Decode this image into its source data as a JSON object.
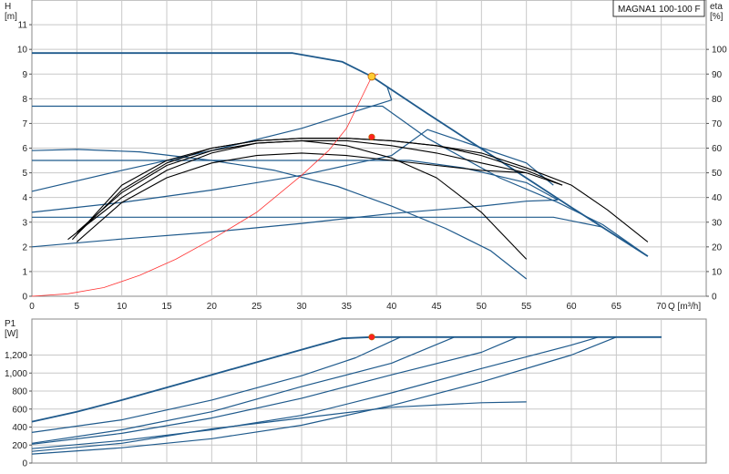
{
  "model_label": "MAGNA1 100-100 F",
  "colors": {
    "grid": "#c8c8c8",
    "axis": "#555555",
    "blue": "#1f5a8c",
    "black": "#000000",
    "red": "#ff3333",
    "op_upper": "#ffcc33",
    "op_lower": "#ff2020"
  },
  "chart_data": [
    {
      "type": "line",
      "title": "",
      "x_axis": {
        "label": "Q [m³/h]",
        "range": [
          0,
          75
        ],
        "ticks": [
          0,
          5,
          10,
          15,
          20,
          25,
          30,
          35,
          40,
          45,
          50,
          55,
          60,
          65,
          70
        ]
      },
      "y_left": {
        "label_top": "H",
        "label_bottom": "[m]",
        "range": [
          0,
          12
        ],
        "ticks": [
          0,
          1,
          2,
          3,
          4,
          5,
          6,
          7,
          8,
          9,
          10,
          11
        ]
      },
      "y_right": {
        "label_top": "eta",
        "label_bottom": "[%]",
        "range": [
          0,
          120
        ],
        "ticks": [
          0,
          10,
          20,
          30,
          40,
          50,
          60,
          70,
          80,
          90,
          100
        ]
      },
      "grid": true,
      "series": [
        {
          "kind": "head",
          "points": [
            [
              0,
              9.85
            ],
            [
              29,
              9.85
            ],
            [
              34.5,
              9.5
            ],
            [
              37.8,
              8.9
            ],
            [
              44,
              7.4
            ],
            [
              52,
              5.5
            ],
            [
              60,
              3.6
            ],
            [
              68.5,
              1.62
            ]
          ]
        },
        {
          "kind": "head",
          "points": [
            [
              0,
              7.7
            ],
            [
              39,
              7.7
            ],
            [
              44,
              6.4
            ],
            [
              52,
              4.8
            ],
            [
              58.5,
              3.8
            ],
            [
              63.5,
              2.9
            ],
            [
              68.5,
              1.62
            ]
          ]
        },
        {
          "kind": "head",
          "points": [
            [
              0,
              5.5
            ],
            [
              42,
              5.5
            ],
            [
              48,
              5.2
            ],
            [
              55,
              4.6
            ],
            [
              58.5,
              3.9
            ]
          ]
        },
        {
          "kind": "head",
          "points": [
            [
              0,
              5.9
            ],
            [
              5,
              5.95
            ],
            [
              12,
              5.85
            ],
            [
              20,
              5.5
            ],
            [
              27,
              5.1
            ],
            [
              34,
              4.45
            ],
            [
              40,
              3.65
            ],
            [
              46,
              2.75
            ],
            [
              51,
              1.85
            ],
            [
              55,
              0.7
            ]
          ]
        },
        {
          "kind": "head",
          "points": [
            [
              0,
              3.2
            ],
            [
              58,
              3.2
            ],
            [
              63.5,
              2.8
            ]
          ]
        },
        {
          "kind": "system",
          "points": [
            [
              0,
              2.0
            ],
            [
              10,
              2.32
            ],
            [
              20,
              2.6
            ],
            [
              30,
              2.95
            ],
            [
              40,
              3.35
            ],
            [
              50,
              3.65
            ],
            [
              55,
              3.85
            ],
            [
              58.5,
              3.9
            ]
          ]
        },
        {
          "kind": "system",
          "points": [
            [
              0,
              3.4
            ],
            [
              10,
              3.8
            ],
            [
              20,
              4.3
            ],
            [
              30,
              4.9
            ],
            [
              40,
              5.7
            ],
            [
              44,
              6.75
            ],
            [
              55,
              5.4
            ],
            [
              58,
              4.5
            ]
          ]
        },
        {
          "kind": "system",
          "points": [
            [
              0,
              4.25
            ],
            [
              10,
              5.1
            ],
            [
              20,
              5.9
            ],
            [
              30,
              6.8
            ],
            [
              40,
              7.95
            ],
            [
              39.5,
              8.5
            ]
          ]
        },
        {
          "kind": "efficiency",
          "points": [
            [
              4.5,
              23
            ],
            [
              10,
              45
            ],
            [
              15,
              55
            ],
            [
              20,
              60
            ],
            [
              25,
              63
            ],
            [
              30,
              64
            ],
            [
              35,
              64
            ],
            [
              40,
              63
            ],
            [
              45,
              61
            ],
            [
              50,
              58
            ],
            [
              55,
              52
            ],
            [
              60,
              45
            ],
            [
              64,
              35
            ],
            [
              68.5,
              22
            ]
          ]
        },
        {
          "kind": "efficiency",
          "points": [
            [
              5,
              25
            ],
            [
              10,
              43
            ],
            [
              15,
              54
            ],
            [
              20,
              60
            ],
            [
              25,
              63
            ],
            [
              30,
              64
            ],
            [
              35,
              64
            ],
            [
              40,
              63
            ],
            [
              45,
              61
            ],
            [
              50,
              57
            ],
            [
              55,
              51
            ],
            [
              59,
              45
            ]
          ]
        },
        {
          "kind": "efficiency",
          "points": [
            [
              5,
              26
            ],
            [
              10,
              42
            ],
            [
              15,
              53
            ],
            [
              20,
              59
            ],
            [
              25,
              62
            ],
            [
              30,
              63
            ],
            [
              35,
              63
            ],
            [
              40,
              61
            ],
            [
              45,
              58
            ],
            [
              50,
              54
            ],
            [
              55,
              50
            ],
            [
              59,
              45
            ]
          ]
        },
        {
          "kind": "efficiency",
          "points": [
            [
              4,
              23
            ],
            [
              10,
              40
            ],
            [
              15,
              51
            ],
            [
              20,
              58
            ],
            [
              25,
              62
            ],
            [
              30,
              63
            ],
            [
              35,
              61
            ],
            [
              40,
              56
            ],
            [
              45,
              48
            ],
            [
              50,
              34
            ],
            [
              55,
              15
            ]
          ]
        },
        {
          "kind": "efficiency",
          "points": [
            [
              5,
              22
            ],
            [
              10,
              38
            ],
            [
              15,
              48
            ],
            [
              20,
              54
            ],
            [
              25,
              57
            ],
            [
              30,
              58
            ],
            [
              35,
              57
            ],
            [
              40,
              55
            ],
            [
              45,
              53
            ],
            [
              50,
              51
            ],
            [
              55,
              50
            ]
          ]
        },
        {
          "kind": "npsh",
          "points": [
            [
              0,
              0
            ],
            [
              4,
              0.1
            ],
            [
              8,
              0.35
            ],
            [
              12,
              0.85
            ],
            [
              16,
              1.5
            ],
            [
              20,
              2.3
            ],
            [
              25,
              3.4
            ],
            [
              30,
              4.9
            ],
            [
              33,
              5.9
            ],
            [
              35,
              6.8
            ],
            [
              37.8,
              8.9
            ],
            [
              38.5,
              9.0
            ]
          ]
        }
      ],
      "operating_points": [
        {
          "marker": "upper",
          "x": 37.8,
          "y": 8.9
        },
        {
          "marker": "lower",
          "x": 37.8,
          "y": 6.45
        }
      ]
    },
    {
      "type": "line",
      "title": "",
      "x_axis": {
        "range": [
          0,
          75
        ]
      },
      "y_left": {
        "label_top": "P1",
        "label_bottom": "[W]",
        "range": [
          0,
          1600
        ],
        "ticks": [
          0,
          200,
          400,
          600,
          800,
          1000,
          1200
        ],
        "tick_labels": [
          "0",
          "200",
          "400",
          "600",
          "800",
          "1,000",
          "1,200"
        ]
      },
      "grid": true,
      "series": [
        {
          "kind": "power",
          "points": [
            [
              0,
              460
            ],
            [
              5,
              570
            ],
            [
              10,
              700
            ],
            [
              15,
              840
            ],
            [
              20,
              980
            ],
            [
              25,
              1120
            ],
            [
              30,
              1260
            ],
            [
              34.5,
              1385
            ],
            [
              37.8,
              1400
            ],
            [
              70,
              1400
            ]
          ]
        },
        {
          "kind": "power",
          "points": [
            [
              0,
              340
            ],
            [
              10,
              480
            ],
            [
              20,
              700
            ],
            [
              30,
              970
            ],
            [
              36,
              1170
            ],
            [
              41,
              1400
            ],
            [
              70,
              1400
            ]
          ]
        },
        {
          "kind": "power",
          "points": [
            [
              0,
              220
            ],
            [
              10,
              370
            ],
            [
              20,
              570
            ],
            [
              30,
              850
            ],
            [
              40,
              1110
            ],
            [
              47,
              1400
            ],
            [
              70,
              1400
            ]
          ]
        },
        {
          "kind": "power",
          "points": [
            [
              0,
              210
            ],
            [
              10,
              330
            ],
            [
              20,
              500
            ],
            [
              30,
              720
            ],
            [
              40,
              980
            ],
            [
              50,
              1230
            ],
            [
              54,
              1400
            ],
            [
              70,
              1400
            ]
          ]
        },
        {
          "kind": "power",
          "points": [
            [
              0,
              160
            ],
            [
              10,
              250
            ],
            [
              20,
              370
            ],
            [
              30,
              530
            ],
            [
              40,
              780
            ],
            [
              50,
              1050
            ],
            [
              60,
              1310
            ],
            [
              63,
              1400
            ],
            [
              70,
              1400
            ]
          ]
        },
        {
          "kind": "power",
          "points": [
            [
              0,
              100
            ],
            [
              10,
              170
            ],
            [
              20,
              270
            ],
            [
              30,
              420
            ],
            [
              40,
              640
            ],
            [
              50,
              900
            ],
            [
              60,
              1200
            ],
            [
              65,
              1400
            ],
            [
              70,
              1400
            ]
          ]
        },
        {
          "kind": "power",
          "points": [
            [
              0,
              130
            ],
            [
              10,
              220
            ],
            [
              20,
              380
            ],
            [
              30,
              500
            ],
            [
              40,
              620
            ],
            [
              50,
              670
            ],
            [
              55,
              680
            ]
          ]
        }
      ],
      "operating_points": [
        {
          "marker": "lower",
          "x": 37.8,
          "y": 1400
        }
      ]
    }
  ]
}
